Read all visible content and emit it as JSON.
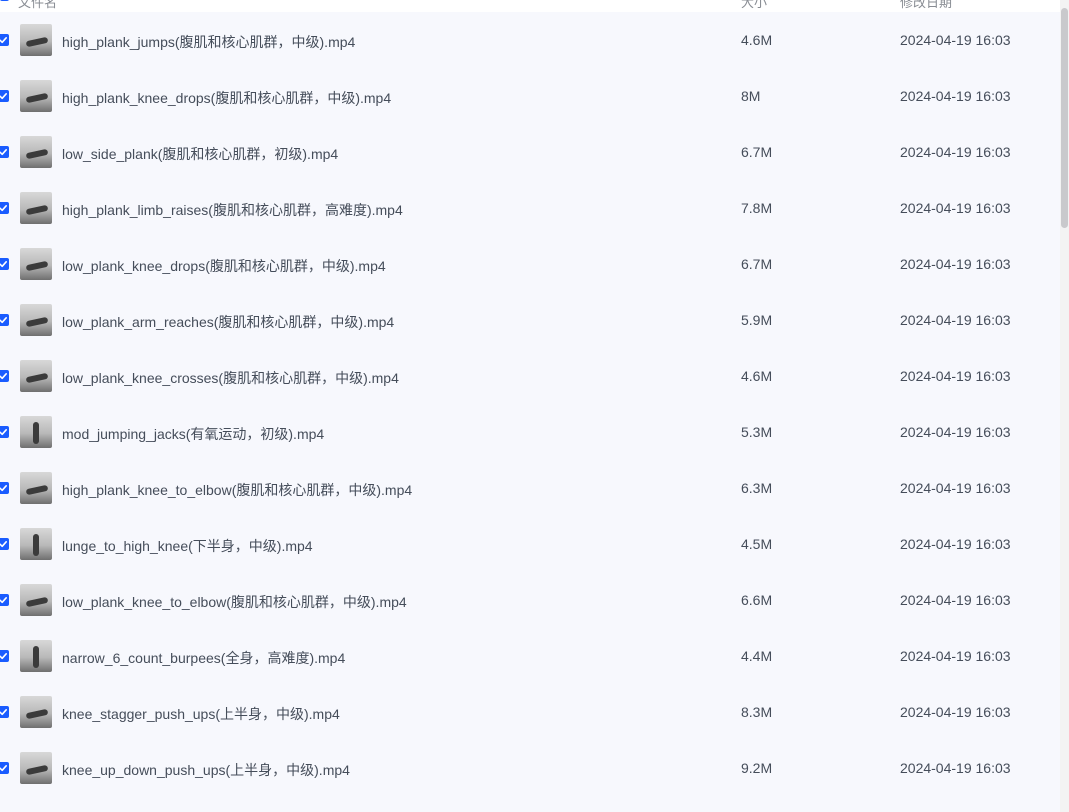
{
  "header": {
    "col_name": "文件名",
    "col_size": "大小",
    "col_date": "修改日期"
  },
  "files": [
    {
      "name": "high_plank_jumps(腹肌和核心肌群，中级).mp4",
      "size": "4.6M",
      "date": "2024-04-19 16:03",
      "checked": true
    },
    {
      "name": "high_plank_knee_drops(腹肌和核心肌群，中级).mp4",
      "size": "8M",
      "date": "2024-04-19 16:03",
      "checked": true
    },
    {
      "name": "low_side_plank(腹肌和核心肌群，初级).mp4",
      "size": "6.7M",
      "date": "2024-04-19 16:03",
      "checked": true
    },
    {
      "name": "high_plank_limb_raises(腹肌和核心肌群，高难度).mp4",
      "size": "7.8M",
      "date": "2024-04-19 16:03",
      "checked": true
    },
    {
      "name": "low_plank_knee_drops(腹肌和核心肌群，中级).mp4",
      "size": "6.7M",
      "date": "2024-04-19 16:03",
      "checked": true
    },
    {
      "name": "low_plank_arm_reaches(腹肌和核心肌群，中级).mp4",
      "size": "5.9M",
      "date": "2024-04-19 16:03",
      "checked": true
    },
    {
      "name": "low_plank_knee_crosses(腹肌和核心肌群，中级).mp4",
      "size": "4.6M",
      "date": "2024-04-19 16:03",
      "checked": true
    },
    {
      "name": "mod_jumping_jacks(有氧运动，初级).mp4",
      "size": "5.3M",
      "date": "2024-04-19 16:03",
      "checked": true
    },
    {
      "name": "high_plank_knee_to_elbow(腹肌和核心肌群，中级).mp4",
      "size": "6.3M",
      "date": "2024-04-19 16:03",
      "checked": true
    },
    {
      "name": "lunge_to_high_knee(下半身，中级).mp4",
      "size": "4.5M",
      "date": "2024-04-19 16:03",
      "checked": true
    },
    {
      "name": "low_plank_knee_to_elbow(腹肌和核心肌群，中级).mp4",
      "size": "6.6M",
      "date": "2024-04-19 16:03",
      "checked": true
    },
    {
      "name": "narrow_6_count_burpees(全身，高难度).mp4",
      "size": "4.4M",
      "date": "2024-04-19 16:03",
      "checked": true
    },
    {
      "name": "knee_stagger_push_ups(上半身，中级).mp4",
      "size": "8.3M",
      "date": "2024-04-19 16:03",
      "checked": true
    },
    {
      "name": "knee_up_down_push_ups(上半身，中级).mp4",
      "size": "9.2M",
      "date": "2024-04-19 16:03",
      "checked": true
    }
  ],
  "colors": {
    "accent": "#1a5cff",
    "row_background": "#f7f8fd",
    "text": "#454d5a"
  },
  "icons": {
    "checkbox": "checkbox-checked-icon",
    "thumbnail": "video-thumbnail"
  }
}
